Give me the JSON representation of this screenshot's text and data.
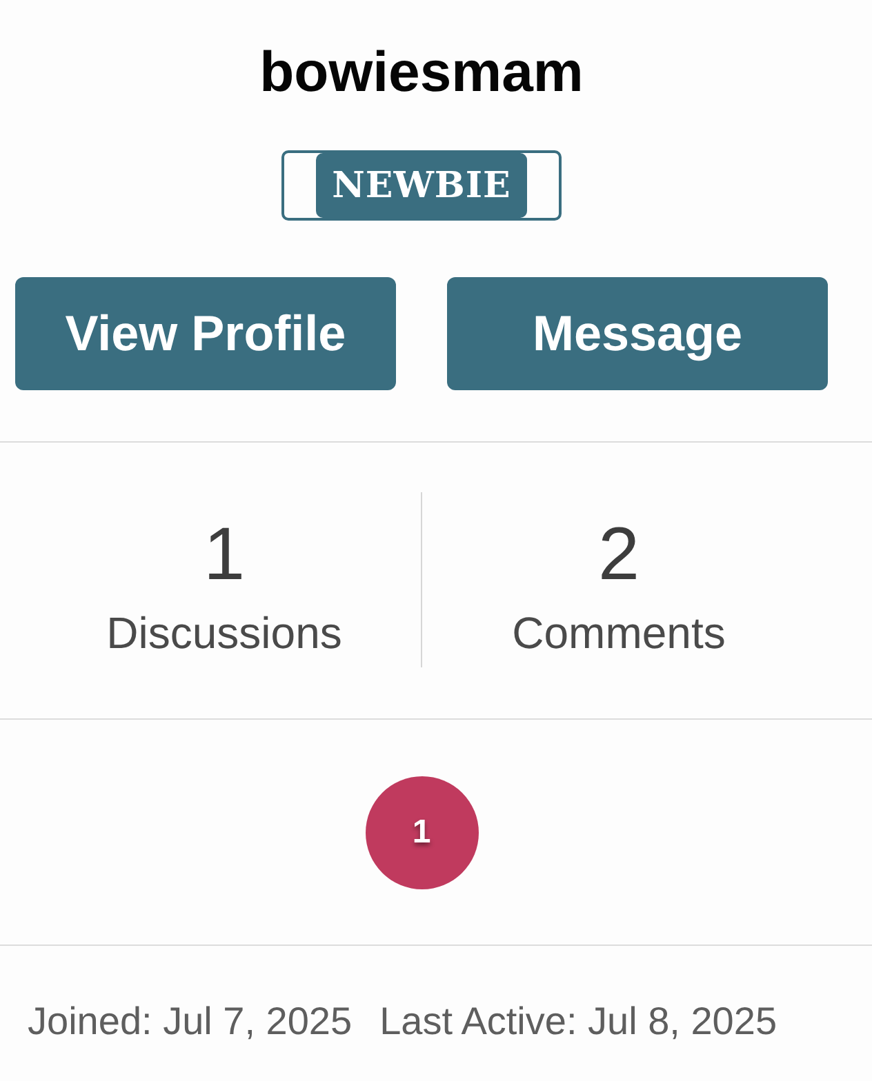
{
  "user": {
    "name": "bowiesmam",
    "rank": "NEWBIE"
  },
  "buttons": [
    {
      "label": "View Profile"
    },
    {
      "label": "Message"
    }
  ],
  "stats": [
    {
      "value": "1",
      "label": "Discussions"
    },
    {
      "value": "2",
      "label": "Comments"
    }
  ],
  "badges": [
    {
      "label": "1"
    }
  ],
  "footer": [
    {
      "text": "Joined: Jul 7, 2025"
    },
    {
      "text": "Last Active: Jul 8, 2025"
    }
  ]
}
